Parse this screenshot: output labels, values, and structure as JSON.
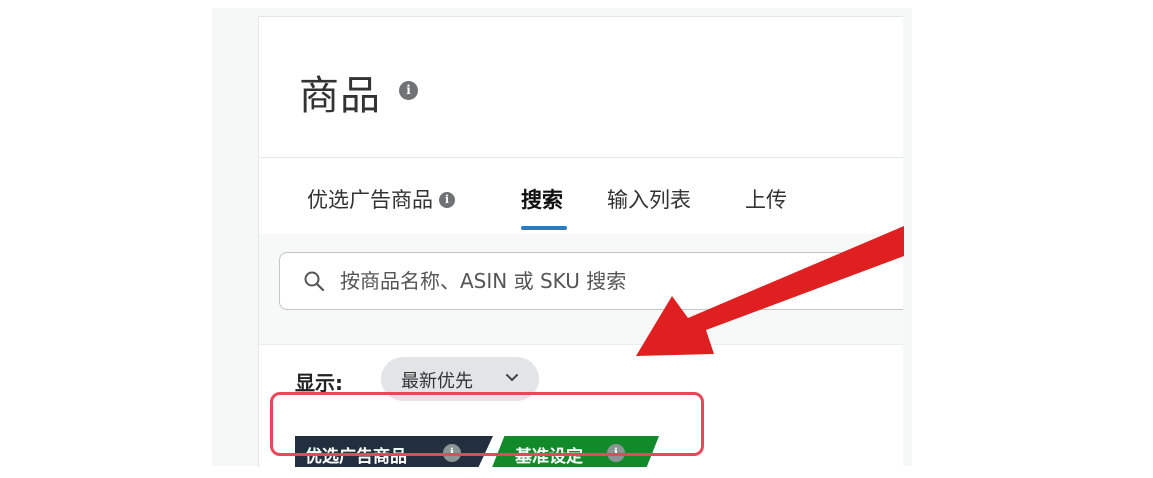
{
  "page": {
    "title": "商品"
  },
  "tabs": [
    {
      "label": "优选广告商品",
      "has_info": true,
      "active": false
    },
    {
      "label": "搜索",
      "has_info": false,
      "active": true
    },
    {
      "label": "输入列表",
      "has_info": false,
      "active": false
    },
    {
      "label": "上传",
      "has_info": false,
      "active": false
    }
  ],
  "search": {
    "placeholder": "按商品名称、ASIN 或 SKU 搜索",
    "icon": "search-icon"
  },
  "filter": {
    "label": "显示:",
    "sort_value": "最新优先",
    "sort_icon": "chevron-down-icon"
  },
  "badges": {
    "featured_label": "优选广告商品",
    "benchmark_label": "基准设定"
  },
  "colors": {
    "accent_tab": "#2b7bbf",
    "badge_dark": "#232f3e",
    "badge_green": "#128a2a",
    "highlight_red": "#e8475a",
    "arrow_red": "#e02020"
  }
}
